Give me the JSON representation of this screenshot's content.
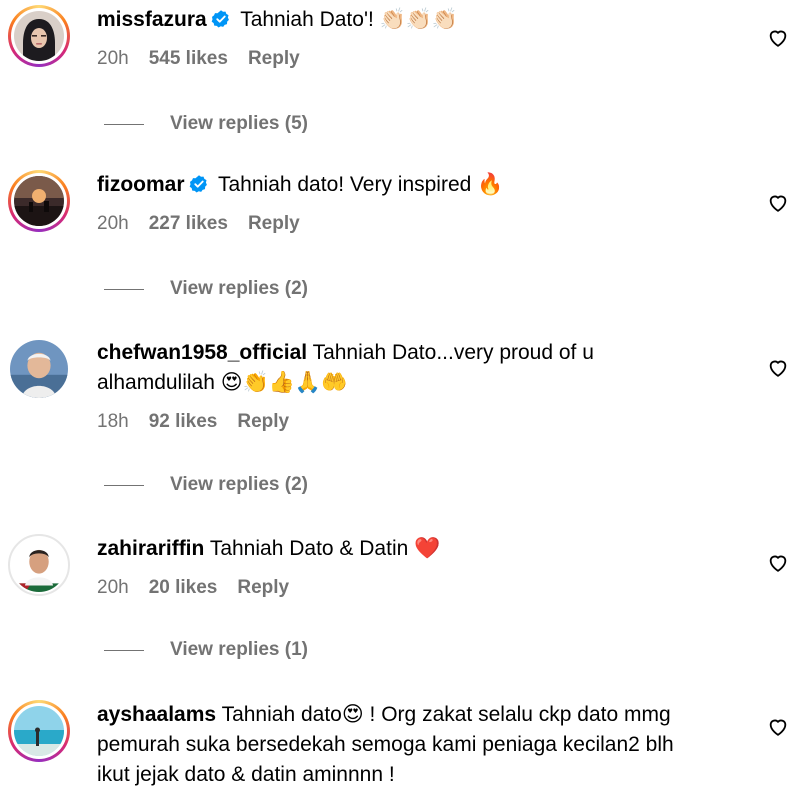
{
  "comments": [
    {
      "username": "missfazura",
      "verified": true,
      "text": "Tahniah Dato'! 👏🏻👏🏻👏🏻",
      "time": "20h",
      "likes": "545 likes",
      "reply_label": "Reply",
      "view_replies": "View replies (5)",
      "avatar_icon": "hijab-portrait-avatar"
    },
    {
      "username": "fizoomar",
      "verified": true,
      "text": "Tahniah dato! Very inspired 🔥",
      "time": "20h",
      "likes": "227 likes",
      "reply_label": "Reply",
      "view_replies": "View replies (2)",
      "avatar_icon": "sunset-stage-avatar"
    },
    {
      "username": "chefwan1958_official",
      "verified": false,
      "text": "Tahniah Dato...very proud of u alhamdulilah 😍👏👍🙏🤲",
      "time": "18h",
      "likes": "92 likes",
      "reply_label": "Reply",
      "view_replies": "View replies (2)",
      "avatar_icon": "elderly-man-avatar"
    },
    {
      "username": "zahirariffin",
      "verified": false,
      "text": "Tahniah Dato & Datin ❤️",
      "time": "20h",
      "likes": "20 likes",
      "reply_label": "Reply",
      "view_replies": "View replies (1)",
      "avatar_icon": "man-portrait-avatar"
    },
    {
      "username": "ayshaalams",
      "verified": false,
      "text": "Tahniah dato😍 ! Org zakat selalu ckp dato mmg pemurah suka bersedekah semoga kami peniaga kecilan2 blh ikut jejak dato & datin aminnnn !",
      "avatar_icon": "beach-avatar"
    }
  ],
  "icons": {
    "like": "heart-outline-icon",
    "verified": "verified-badge-icon"
  },
  "colors": {
    "secondary_text": "#737373",
    "verified_blue": "#0095f6",
    "story_ring": [
      "#feda75",
      "#fa7e1e",
      "#d62976",
      "#962fbf"
    ]
  }
}
